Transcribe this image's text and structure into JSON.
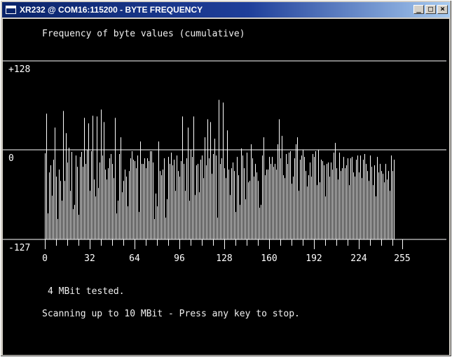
{
  "window": {
    "title": "XR232 @ COM16:115200 - BYTE FREQUENCY",
    "minimize_label": "_",
    "maximize_label": "□",
    "close_label": "×"
  },
  "console": {
    "heading": "Frequency of byte values (cumulative)",
    "status_tested": "4 MBit tested.",
    "status_scanning": "Scanning up to 10 MBit - Press any key to stop.",
    "colors": {
      "background": "#000000",
      "foreground": "#ffffff"
    }
  },
  "chart_data": {
    "type": "bar",
    "title": "Frequency of byte values (cumulative)",
    "xlabel": "",
    "ylabel": "",
    "xlim": [
      0,
      255
    ],
    "ylim": [
      -127,
      128
    ],
    "y_ticks": [
      {
        "value": 128,
        "label": "+128"
      },
      {
        "value": 0,
        "label": "0"
      },
      {
        "value": -127,
        "label": "-127"
      }
    ],
    "x_ticks": [
      0,
      32,
      64,
      96,
      128,
      160,
      192,
      224,
      255
    ],
    "minor_tick_step": 8,
    "grid": "horizontal lines at +128, 0, -127",
    "values": [
      -5,
      52,
      -90,
      -32,
      -22,
      -65,
      -14,
      32,
      -38,
      -98,
      -28,
      -44,
      -72,
      56,
      -44,
      24,
      -18,
      3,
      -58,
      -3,
      -84,
      -78,
      -8,
      -24,
      -92,
      -10,
      -3,
      -24,
      46,
      -20,
      0,
      38,
      -58,
      -2,
      49,
      -42,
      -66,
      48,
      -54,
      -18,
      58,
      -8,
      40,
      -28,
      -42,
      -26,
      -12,
      -6,
      -20,
      -40,
      46,
      -90,
      -72,
      -6,
      18,
      -60,
      -44,
      -28,
      -38,
      -80,
      -30,
      -12,
      -2,
      -14,
      -16,
      -26,
      -8,
      -88,
      12,
      -20,
      -20,
      -12,
      -26,
      -12,
      -16,
      -2,
      -2,
      -18,
      -98,
      -62,
      -80,
      12,
      -30,
      -36,
      -28,
      -12,
      -96,
      -70,
      -10,
      -20,
      -4,
      -22,
      -14,
      -58,
      -8,
      -30,
      -38,
      -16,
      48,
      -20,
      -58,
      -12,
      32,
      -72,
      0,
      -10,
      48,
      -64,
      -22,
      -20,
      -60,
      -14,
      -8,
      -40,
      18,
      -22,
      44,
      -12,
      40,
      -34,
      -6,
      16,
      -8,
      -96,
      72,
      -20,
      -12,
      68,
      -26,
      -40,
      28,
      -28,
      -64,
      -26,
      -18,
      -30,
      -88,
      -10,
      -36,
      -78,
      2,
      -8,
      -26,
      -70,
      -4,
      -46,
      -44,
      8,
      -12,
      -38,
      -20,
      -32,
      -44,
      -82,
      -78,
      -8,
      18,
      -36,
      -28,
      -28,
      -10,
      -20,
      -10,
      -24,
      -20,
      -28,
      8,
      44,
      -12,
      20,
      -36,
      -40,
      -6,
      -20,
      -4,
      -2,
      -48,
      -38,
      -12,
      8,
      18,
      -58,
      -14,
      -8,
      0,
      -10,
      -30,
      -52,
      -36,
      -18,
      -38,
      -6,
      -10,
      -2,
      -50,
      0,
      -46,
      -14,
      -16,
      -22,
      -66,
      -20,
      -18,
      -38,
      -18,
      -28,
      -4,
      10,
      -26,
      -42,
      -4,
      -30,
      -26,
      -10,
      -26,
      -22,
      -12,
      -50,
      -12,
      -10,
      -32,
      -38,
      -14,
      -8,
      -32,
      -8,
      -40,
      -14,
      -6,
      -20,
      -30,
      -44,
      -8,
      -24,
      -50,
      -22,
      -66,
      -10,
      -32,
      -20,
      -30,
      -34,
      -46,
      -20,
      -42,
      -30,
      -58,
      -8,
      -30,
      -14
    ]
  }
}
